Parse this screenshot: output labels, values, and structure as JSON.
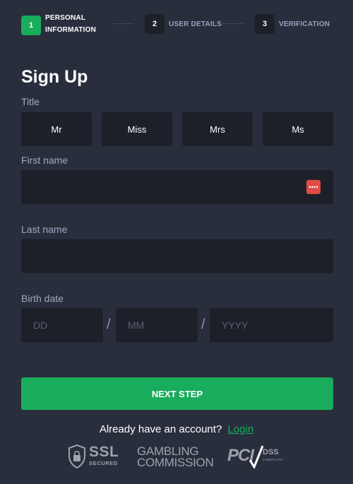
{
  "stepper": {
    "steps": [
      {
        "number": "1",
        "label": "Personal Information",
        "state": "active"
      },
      {
        "number": "2",
        "label": "User Details",
        "state": "inactive"
      },
      {
        "number": "3",
        "label": "Verification",
        "state": "inactive"
      }
    ]
  },
  "form": {
    "title": "Sign Up",
    "title_field": {
      "label": "Title",
      "options": [
        "Mr",
        "Miss",
        "Mrs",
        "Ms"
      ]
    },
    "first_name": {
      "label": "First name",
      "value": "",
      "placeholder": ""
    },
    "last_name": {
      "label": "Last name",
      "value": "",
      "placeholder": ""
    },
    "birth_date": {
      "label": "Birth date",
      "day_placeholder": "DD",
      "month_placeholder": "MM",
      "year_placeholder": "YYYY",
      "separator": "/"
    },
    "next_button": "Next Step"
  },
  "login": {
    "prompt": "Already have an account?",
    "link": "Login"
  },
  "badges": {
    "ssl_title": "SSL",
    "ssl_subtitle": "SECURED",
    "gambling_line1": "GAMBLING",
    "gambling_line2": "COMMISSION",
    "pci_text": "PCI",
    "dss_text": "DSS",
    "dss_subtitle": "COMPLIANT"
  },
  "colors": {
    "background": "#292e3d",
    "field_background": "#1d2029",
    "accent_green": "#1aac5d",
    "badge_red": "#e04b45",
    "label_text": "#a3a8c2"
  },
  "icons": {
    "password_manager": "password-dots-icon",
    "ssl": "shield-lock-icon",
    "pci": "checkmark-icon"
  }
}
